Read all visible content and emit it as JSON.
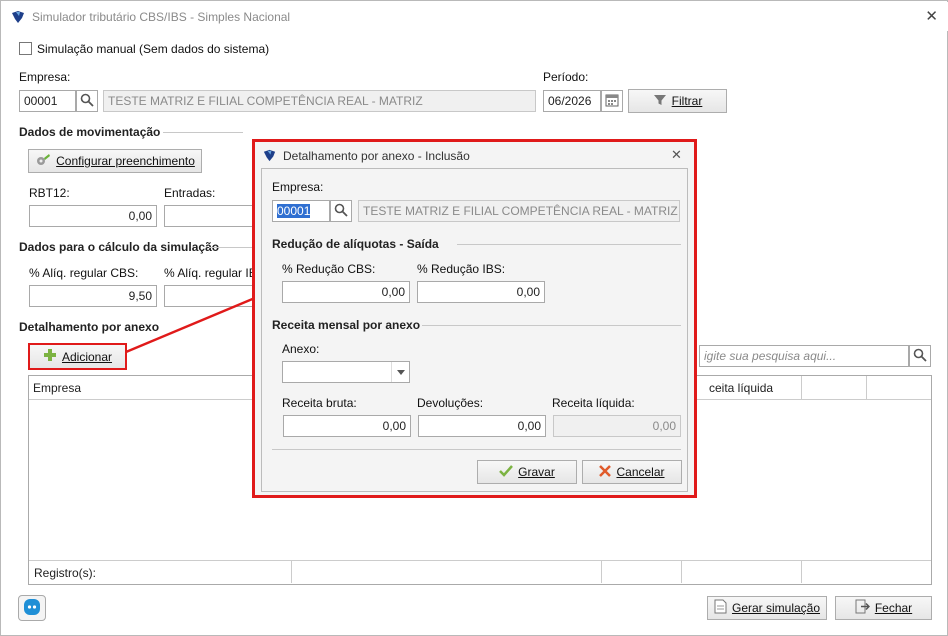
{
  "window": {
    "title": "Simulador tributário CBS/IBS - Simples Nacional"
  },
  "manual": {
    "label": "Simulação manual (Sem dados do sistema)"
  },
  "empresa": {
    "label": "Empresa:",
    "code": "00001",
    "name": "TESTE MATRIZ E FILIAL COMPETÊNCIA REAL - MATRIZ"
  },
  "periodo": {
    "label": "Período:",
    "value": "06/2026"
  },
  "filter": {
    "label": "Filtrar"
  },
  "movimentacao": {
    "title": "Dados de movimentação",
    "configure_label": "Configurar preenchimento",
    "rbt12_label": "RBT12:",
    "rbt12_value": "0,00",
    "entradas_label": "Entradas:"
  },
  "calculo": {
    "title": "Dados para o cálculo da simulação",
    "cbs_label": "% Alíq. regular CBS:",
    "cbs_value": "9,50",
    "ibs_label": "% Alíq. regular IB"
  },
  "detalhamento": {
    "title": "Detalhamento por anexo",
    "add_label": "Adicionar",
    "search_placeholder": "igite sua pesquisa aqui...",
    "col_empresa": "Empresa",
    "col_receita": "ceita líquida",
    "footer_label": "Registro(s):"
  },
  "bottom": {
    "gerar_label": "Gerar simulação",
    "fechar_label": "Fechar"
  },
  "dialog": {
    "title": "Detalhamento por anexo - Inclusão",
    "empresa_label": "Empresa:",
    "empresa_code": "00001",
    "empresa_name": "TESTE MATRIZ E FILIAL COMPETÊNCIA REAL - MATRIZ",
    "reducao_title": "Redução de alíquotas - Saída",
    "red_cbs_label": "% Redução CBS:",
    "red_cbs_value": "0,00",
    "red_ibs_label": "% Redução IBS:",
    "red_ibs_value": "0,00",
    "receita_title": "Receita mensal por anexo",
    "anexo_label": "Anexo:",
    "anexo_value": "",
    "bruta_label": "Receita bruta:",
    "bruta_value": "0,00",
    "devol_label": "Devoluções:",
    "devol_value": "0,00",
    "liquida_label": "Receita líquida:",
    "liquida_value": "0,00",
    "gravar_label": "Gravar",
    "cancelar_label": "Cancelar"
  },
  "colors": {
    "highlight": "#e01a1a",
    "accent": "#1f8fd6",
    "add_icon": "#7cb342"
  }
}
